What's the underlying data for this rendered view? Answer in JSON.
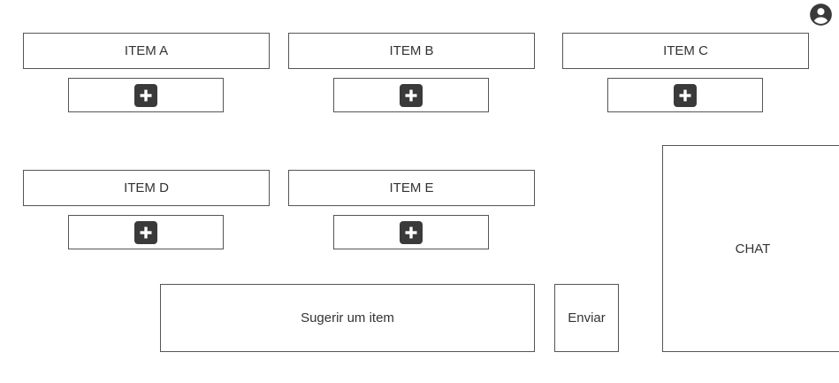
{
  "items": [
    {
      "label": "ITEM A"
    },
    {
      "label": "ITEM B"
    },
    {
      "label": "ITEM C"
    },
    {
      "label": "ITEM D"
    },
    {
      "label": "ITEM E"
    }
  ],
  "suggest": {
    "label": "Sugerir um item"
  },
  "send": {
    "label": "Enviar"
  },
  "chat": {
    "label": "CHAT"
  },
  "icons": {
    "add": "plus-square-icon",
    "account": "account-circle-icon"
  },
  "colors": {
    "border": "#555555",
    "icon": "#3a3a3a",
    "text": "#333333"
  }
}
